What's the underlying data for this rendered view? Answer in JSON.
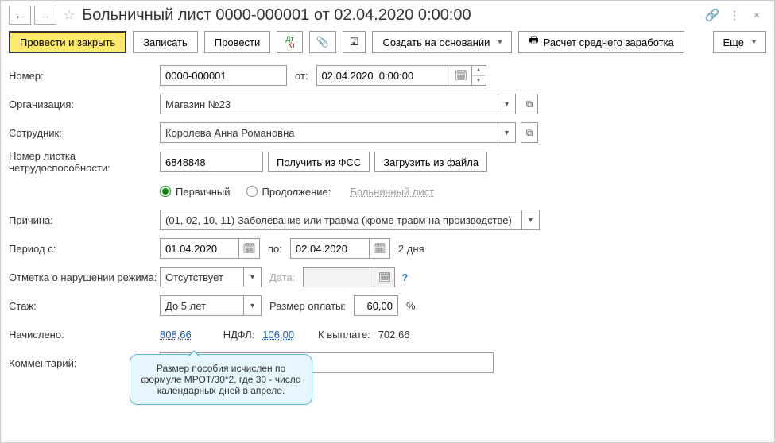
{
  "header": {
    "title": "Больничный лист 0000-000001 от 02.04.2020 0:00:00"
  },
  "toolbar": {
    "submit_close": "Провести и закрыть",
    "save": "Записать",
    "submit": "Провести",
    "create_based": "Создать на основании",
    "avg_calc": "Расчет среднего заработка",
    "more": "Еще"
  },
  "labels": {
    "number": "Номер:",
    "from": "от:",
    "org": "Организация:",
    "employee": "Сотрудник:",
    "sicknote": "Номер листка нетрудоспособности:",
    "get_fss": "Получить из ФСС",
    "load_file": "Загрузить из файла",
    "primary": "Первичный",
    "continuation": "Продолжение:",
    "sicklist_link": "Больничный лист",
    "reason": "Причина:",
    "period_from": "Период с:",
    "to": "по:",
    "days": "2 дня",
    "violation": "Отметка о нарушении режима:",
    "date": "Дата:",
    "seniority": "Стаж:",
    "pay_size": "Размер оплаты:",
    "percent": "%",
    "accrued": "Начислено:",
    "ndfl": "НДФЛ:",
    "to_pay": "К выплате:",
    "comment": "Комментарий:"
  },
  "values": {
    "number": "0000-000001",
    "date": "02.04.2020  0:00:00",
    "org": "Магазин №23",
    "employee": "Королева Анна Романовна",
    "sicknum": "6848848",
    "reason": "(01, 02, 10, 11) Заболевание или травма (кроме травм на производстве)",
    "period_from": "01.04.2020",
    "period_to": "02.04.2020",
    "violation": "Отсутствует",
    "violation_date": "",
    "seniority": "До 5 лет",
    "pay_size": "60,00",
    "accrued": "808,66",
    "ndfl": "106,00",
    "to_pay": "702,66",
    "comment": ""
  },
  "callout": {
    "text": "Размер пособия исчислен по формуле МРОТ/30*2, где 30 - число календарных дней в апреле."
  }
}
